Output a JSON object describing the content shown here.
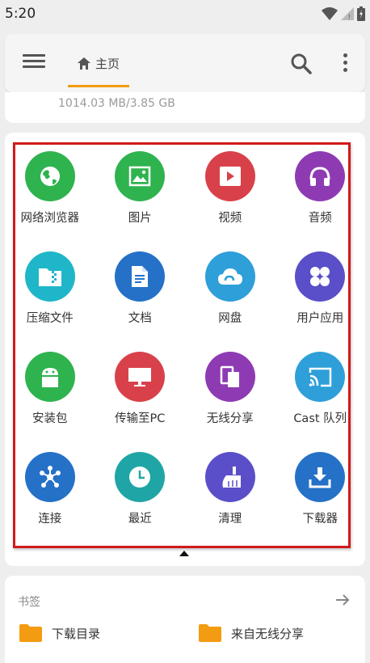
{
  "status_bar": {
    "time": "5:20"
  },
  "appbar": {
    "home_tab_label": "主页"
  },
  "storage": {
    "usage_text": "1014.03 MB/3.85 GB"
  },
  "categories": [
    {
      "label": "网络浏览器",
      "icon": "globe-icon",
      "color": "#2fb34f"
    },
    {
      "label": "图片",
      "icon": "image-icon",
      "color": "#2fb34f"
    },
    {
      "label": "视频",
      "icon": "video-icon",
      "color": "#d9414a"
    },
    {
      "label": "音频",
      "icon": "headphones-icon",
      "color": "#8e3bb3"
    },
    {
      "label": "压缩文件",
      "icon": "archive-icon",
      "color": "#1fb6c9"
    },
    {
      "label": "文档",
      "icon": "document-icon",
      "color": "#2471c7"
    },
    {
      "label": "网盘",
      "icon": "cloud-icon",
      "color": "#2e9fd8"
    },
    {
      "label": "用户应用",
      "icon": "apps-icon",
      "color": "#5a4fc8"
    },
    {
      "label": "安装包",
      "icon": "android-icon",
      "color": "#2fb34f"
    },
    {
      "label": "传输至PC",
      "icon": "monitor-icon",
      "color": "#d9414a"
    },
    {
      "label": "无线分享",
      "icon": "share-icon",
      "color": "#8e3bb3"
    },
    {
      "label": "Cast 队列",
      "icon": "cast-icon",
      "color": "#2e9fd8"
    },
    {
      "label": "连接",
      "icon": "network-icon",
      "color": "#2471c7"
    },
    {
      "label": "最近",
      "icon": "clock-icon",
      "color": "#1fa5a5"
    },
    {
      "label": "清理",
      "icon": "broom-icon",
      "color": "#5a4fc8"
    },
    {
      "label": "下载器",
      "icon": "download-icon",
      "color": "#2471c7"
    }
  ],
  "bookmarks": {
    "title": "书签",
    "items": [
      {
        "label": "下载目录",
        "icon": "folder-icon",
        "color": "#f39c12"
      },
      {
        "label": "来自无线分享",
        "icon": "folder-icon",
        "color": "#f39c12"
      }
    ]
  }
}
